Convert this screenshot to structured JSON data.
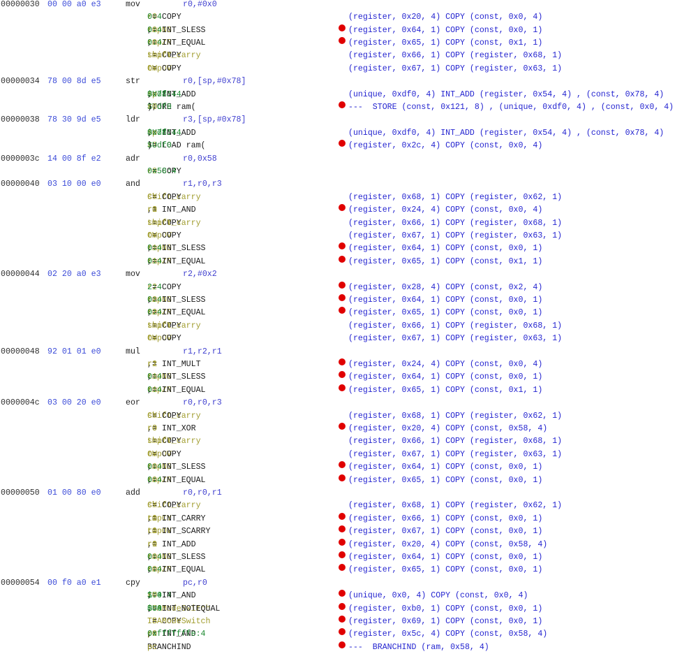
{
  "instructions": [
    {
      "addr": "00000030",
      "bytes": "00 00 a0 e3",
      "mnemonic": "mov",
      "operands": "r0,#0x0",
      "pcode": [
        {
          "tokens": [
            [
              "n",
              "r0"
            ],
            [
              "k",
              " = COPY "
            ],
            [
              "c",
              "0:4"
            ]
          ],
          "bp": false,
          "raw": "(register, 0x20, 4) COPY (const, 0x0, 4)"
        },
        {
          "tokens": [
            [
              "n",
              "tmpNG"
            ],
            [
              "k",
              " = INT_SLESS "
            ],
            [
              "n",
              "r0"
            ],
            [
              "k",
              ", "
            ],
            [
              "c",
              "0:4"
            ]
          ],
          "bp": true,
          "raw": "(register, 0x64, 1) COPY (const, 0x0, 1)"
        },
        {
          "tokens": [
            [
              "n",
              "tmpZR"
            ],
            [
              "k",
              " = INT_EQUAL "
            ],
            [
              "n",
              "r0"
            ],
            [
              "k",
              ", "
            ],
            [
              "c",
              "0:4"
            ]
          ],
          "bp": true,
          "raw": "(register, 0x65, 1) COPY (const, 0x1, 1)"
        },
        {
          "tokens": [
            [
              "n",
              "tmpCY"
            ],
            [
              "k",
              " = COPY "
            ],
            [
              "n",
              "shift_carry"
            ]
          ],
          "bp": false,
          "raw": "(register, 0x66, 1) COPY (register, 0x68, 1)"
        },
        {
          "tokens": [
            [
              "n",
              "tmpOV"
            ],
            [
              "k",
              " = COPY "
            ],
            [
              "n",
              "OV"
            ]
          ],
          "bp": false,
          "raw": "(register, 0x67, 1) COPY (register, 0x63, 1)"
        }
      ]
    },
    {
      "addr": "00000034",
      "bytes": "78 00 8d e5",
      "mnemonic": "str",
      "operands": "r0,[sp,#0x78]",
      "pcode": [
        {
          "tokens": [
            [
              "c",
              "$Udf0:4"
            ],
            [
              "k",
              " = INT_ADD "
            ],
            [
              "n",
              "sp"
            ],
            [
              "k",
              ", "
            ],
            [
              "c",
              "0x78:4"
            ]
          ],
          "bp": false,
          "raw": "(unique, 0xdf0, 4) INT_ADD (register, 0x54, 4) , (const, 0x78, 4)"
        },
        {
          "tokens": [
            [
              "k",
              "STORE ram("
            ],
            [
              "c",
              "$Udf0"
            ],
            [
              "k",
              "), "
            ],
            [
              "n",
              "r0"
            ]
          ],
          "bp": true,
          "raw": "---  STORE (const, 0x121, 8) , (unique, 0xdf0, 4) , (const, 0x0, 4)"
        }
      ]
    },
    {
      "addr": "00000038",
      "bytes": "78 30 9d e5",
      "mnemonic": "ldr",
      "operands": "r3,[sp,#0x78]",
      "pcode": [
        {
          "tokens": [
            [
              "c",
              "$Udf0:4"
            ],
            [
              "k",
              " = INT_ADD "
            ],
            [
              "n",
              "sp"
            ],
            [
              "k",
              ", "
            ],
            [
              "c",
              "0x78:4"
            ]
          ],
          "bp": false,
          "raw": "(unique, 0xdf0, 4) INT_ADD (register, 0x54, 4) , (const, 0x78, 4)"
        },
        {
          "tokens": [
            [
              "n",
              "r3"
            ],
            [
              "k",
              " = LOAD ram("
            ],
            [
              "c",
              "$Udf0"
            ],
            [
              "k",
              ")"
            ]
          ],
          "bp": true,
          "raw": "(register, 0x2c, 4) COPY (const, 0x0, 4)"
        }
      ]
    },
    {
      "addr": "0000003c",
      "bytes": "14 00 8f e2",
      "mnemonic": "adr",
      "operands": "r0,0x58",
      "pcode": [
        {
          "tokens": [
            [
              "n",
              "r0"
            ],
            [
              "k",
              " = COPY "
            ],
            [
              "c",
              "0x58:4"
            ]
          ],
          "bp": false,
          "raw": ""
        }
      ]
    },
    {
      "addr": "00000040",
      "bytes": "03 10 00 e0",
      "mnemonic": "and",
      "operands": "r1,r0,r3",
      "pcode": [
        {
          "tokens": [
            [
              "n",
              "shift_carry"
            ],
            [
              "k",
              " = COPY "
            ],
            [
              "n",
              "CY"
            ]
          ],
          "bp": false,
          "raw": "(register, 0x68, 1) COPY (register, 0x62, 1)"
        },
        {
          "tokens": [
            [
              "n",
              "r1"
            ],
            [
              "k",
              " = INT_AND "
            ],
            [
              "n",
              "r0"
            ],
            [
              "k",
              ", "
            ],
            [
              "n",
              "r3"
            ]
          ],
          "bp": true,
          "raw": "(register, 0x24, 4) COPY (const, 0x0, 4)"
        },
        {
          "tokens": [
            [
              "n",
              "tmpCY"
            ],
            [
              "k",
              " = COPY "
            ],
            [
              "n",
              "shift_carry"
            ]
          ],
          "bp": false,
          "raw": "(register, 0x66, 1) COPY (register, 0x68, 1)"
        },
        {
          "tokens": [
            [
              "n",
              "tmpOV"
            ],
            [
              "k",
              " = COPY "
            ],
            [
              "n",
              "OV"
            ]
          ],
          "bp": false,
          "raw": "(register, 0x67, 1) COPY (register, 0x63, 1)"
        },
        {
          "tokens": [
            [
              "n",
              "tmpNG"
            ],
            [
              "k",
              " = INT_SLESS "
            ],
            [
              "n",
              "r1"
            ],
            [
              "k",
              ", "
            ],
            [
              "c",
              "0:4"
            ]
          ],
          "bp": true,
          "raw": "(register, 0x64, 1) COPY (const, 0x0, 1)"
        },
        {
          "tokens": [
            [
              "n",
              "tmpZR"
            ],
            [
              "k",
              " = INT_EQUAL "
            ],
            [
              "n",
              "r1"
            ],
            [
              "k",
              ", "
            ],
            [
              "c",
              "0:4"
            ]
          ],
          "bp": true,
          "raw": "(register, 0x65, 1) COPY (const, 0x1, 1)"
        }
      ]
    },
    {
      "addr": "00000044",
      "bytes": "02 20 a0 e3",
      "mnemonic": "mov",
      "operands": "r2,#0x2",
      "pcode": [
        {
          "tokens": [
            [
              "n",
              "r2"
            ],
            [
              "k",
              " = COPY "
            ],
            [
              "c",
              "2:4"
            ]
          ],
          "bp": true,
          "raw": "(register, 0x28, 4) COPY (const, 0x2, 4)"
        },
        {
          "tokens": [
            [
              "n",
              "tmpNG"
            ],
            [
              "k",
              " = INT_SLESS "
            ],
            [
              "n",
              "r2"
            ],
            [
              "k",
              ", "
            ],
            [
              "c",
              "0:4"
            ]
          ],
          "bp": true,
          "raw": "(register, 0x64, 1) COPY (const, 0x0, 1)"
        },
        {
          "tokens": [
            [
              "n",
              "tmpZR"
            ],
            [
              "k",
              " = INT_EQUAL "
            ],
            [
              "n",
              "r2"
            ],
            [
              "k",
              ", "
            ],
            [
              "c",
              "0:4"
            ]
          ],
          "bp": true,
          "raw": "(register, 0x65, 1) COPY (const, 0x0, 1)"
        },
        {
          "tokens": [
            [
              "n",
              "tmpCY"
            ],
            [
              "k",
              " = COPY "
            ],
            [
              "n",
              "shift_carry"
            ]
          ],
          "bp": false,
          "raw": "(register, 0x66, 1) COPY (register, 0x68, 1)"
        },
        {
          "tokens": [
            [
              "n",
              "tmpOV"
            ],
            [
              "k",
              " = COPY "
            ],
            [
              "n",
              "OV"
            ]
          ],
          "bp": false,
          "raw": "(register, 0x67, 1) COPY (register, 0x63, 1)"
        }
      ]
    },
    {
      "addr": "00000048",
      "bytes": "92 01 01 e0",
      "mnemonic": "mul",
      "operands": "r1,r2,r1",
      "pcode": [
        {
          "tokens": [
            [
              "n",
              "r1"
            ],
            [
              "k",
              " = INT_MULT "
            ],
            [
              "n",
              "r2"
            ],
            [
              "k",
              ", "
            ],
            [
              "n",
              "r1"
            ]
          ],
          "bp": true,
          "raw": "(register, 0x24, 4) COPY (const, 0x0, 4)"
        },
        {
          "tokens": [
            [
              "n",
              "tmpNG"
            ],
            [
              "k",
              " = INT_SLESS "
            ],
            [
              "n",
              "r1"
            ],
            [
              "k",
              ", "
            ],
            [
              "c",
              "0:4"
            ]
          ],
          "bp": true,
          "raw": "(register, 0x64, 1) COPY (const, 0x0, 1)"
        },
        {
          "tokens": [
            [
              "n",
              "tmpZR"
            ],
            [
              "k",
              " = INT_EQUAL "
            ],
            [
              "n",
              "r1"
            ],
            [
              "k",
              ", "
            ],
            [
              "c",
              "0:4"
            ]
          ],
          "bp": true,
          "raw": "(register, 0x65, 1) COPY (const, 0x1, 1)"
        }
      ]
    },
    {
      "addr": "0000004c",
      "bytes": "03 00 20 e0",
      "mnemonic": "eor",
      "operands": "r0,r0,r3",
      "pcode": [
        {
          "tokens": [
            [
              "n",
              "shift_carry"
            ],
            [
              "k",
              " = COPY "
            ],
            [
              "n",
              "CY"
            ]
          ],
          "bp": false,
          "raw": "(register, 0x68, 1) COPY (register, 0x62, 1)"
        },
        {
          "tokens": [
            [
              "n",
              "r0"
            ],
            [
              "k",
              " = INT_XOR "
            ],
            [
              "n",
              "r0"
            ],
            [
              "k",
              ", "
            ],
            [
              "n",
              "r3"
            ]
          ],
          "bp": true,
          "raw": "(register, 0x20, 4) COPY (const, 0x58, 4)"
        },
        {
          "tokens": [
            [
              "n",
              "tmpCY"
            ],
            [
              "k",
              " = COPY "
            ],
            [
              "n",
              "shift_carry"
            ]
          ],
          "bp": false,
          "raw": "(register, 0x66, 1) COPY (register, 0x68, 1)"
        },
        {
          "tokens": [
            [
              "n",
              "tmpOV"
            ],
            [
              "k",
              " = COPY "
            ],
            [
              "n",
              "OV"
            ]
          ],
          "bp": false,
          "raw": "(register, 0x67, 1) COPY (register, 0x63, 1)"
        },
        {
          "tokens": [
            [
              "n",
              "tmpNG"
            ],
            [
              "k",
              " = INT_SLESS "
            ],
            [
              "n",
              "r0"
            ],
            [
              "k",
              ", "
            ],
            [
              "c",
              "0:4"
            ]
          ],
          "bp": true,
          "raw": "(register, 0x64, 1) COPY (const, 0x0, 1)"
        },
        {
          "tokens": [
            [
              "n",
              "tmpZR"
            ],
            [
              "k",
              " = INT_EQUAL "
            ],
            [
              "n",
              "r0"
            ],
            [
              "k",
              ", "
            ],
            [
              "c",
              "0:4"
            ]
          ],
          "bp": true,
          "raw": "(register, 0x65, 1) COPY (const, 0x0, 1)"
        }
      ]
    },
    {
      "addr": "00000050",
      "bytes": "01 00 80 e0",
      "mnemonic": "add",
      "operands": "r0,r0,r1",
      "pcode": [
        {
          "tokens": [
            [
              "n",
              "shift_carry"
            ],
            [
              "k",
              " = COPY "
            ],
            [
              "n",
              "CY"
            ]
          ],
          "bp": false,
          "raw": "(register, 0x68, 1) COPY (register, 0x62, 1)"
        },
        {
          "tokens": [
            [
              "n",
              "tmpCY"
            ],
            [
              "k",
              " = INT_CARRY "
            ],
            [
              "n",
              "r0"
            ],
            [
              "k",
              ", "
            ],
            [
              "n",
              "r1"
            ]
          ],
          "bp": true,
          "raw": "(register, 0x66, 1) COPY (const, 0x0, 1)"
        },
        {
          "tokens": [
            [
              "n",
              "tmpOV"
            ],
            [
              "k",
              " = INT_SCARRY "
            ],
            [
              "n",
              "r0"
            ],
            [
              "k",
              ", "
            ],
            [
              "n",
              "r1"
            ]
          ],
          "bp": true,
          "raw": "(register, 0x67, 1) COPY (const, 0x0, 1)"
        },
        {
          "tokens": [
            [
              "n",
              "r0"
            ],
            [
              "k",
              " = INT_ADD "
            ],
            [
              "n",
              "r0"
            ],
            [
              "k",
              ", "
            ],
            [
              "n",
              "r1"
            ]
          ],
          "bp": true,
          "raw": "(register, 0x20, 4) COPY (const, 0x58, 4)"
        },
        {
          "tokens": [
            [
              "n",
              "tmpNG"
            ],
            [
              "k",
              " = INT_SLESS "
            ],
            [
              "n",
              "r0"
            ],
            [
              "k",
              ", "
            ],
            [
              "c",
              "0:4"
            ]
          ],
          "bp": true,
          "raw": "(register, 0x64, 1) COPY (const, 0x0, 1)"
        },
        {
          "tokens": [
            [
              "n",
              "tmpZR"
            ],
            [
              "k",
              " = INT_EQUAL "
            ],
            [
              "n",
              "r0"
            ],
            [
              "k",
              ", "
            ],
            [
              "c",
              "0:4"
            ]
          ],
          "bp": true,
          "raw": "(register, 0x65, 1) COPY (const, 0x0, 1)"
        }
      ]
    },
    {
      "addr": "00000054",
      "bytes": "00 f0 a0 e1",
      "mnemonic": "cpy",
      "operands": "pc,r0",
      "pcode": [
        {
          "tokens": [
            [
              "c",
              "$U0:4"
            ],
            [
              "k",
              " = INT_AND "
            ],
            [
              "n",
              "r0"
            ],
            [
              "k",
              ", "
            ],
            [
              "c",
              "1:4"
            ]
          ],
          "bp": true,
          "raw": "(unique, 0x0, 4) COPY (const, 0x0, 4)"
        },
        {
          "tokens": [
            [
              "n",
              "ISAModeSwitch"
            ],
            [
              "k",
              " = INT_NOTEQUAL "
            ],
            [
              "c",
              "$U0"
            ],
            [
              "k",
              ", "
            ],
            [
              "c",
              "0:4"
            ]
          ],
          "bp": true,
          "raw": "(register, 0xb0, 1) COPY (const, 0x0, 1)"
        },
        {
          "tokens": [
            [
              "n",
              "TB"
            ],
            [
              "k",
              " = COPY "
            ],
            [
              "n",
              "ISAModeSwitch"
            ]
          ],
          "bp": true,
          "raw": "(register, 0x69, 1) COPY (const, 0x0, 1)"
        },
        {
          "tokens": [
            [
              "n",
              "pc"
            ],
            [
              "k",
              " = INT_AND "
            ],
            [
              "n",
              "r0"
            ],
            [
              "k",
              ", "
            ],
            [
              "c",
              "0xfffffffe:4"
            ]
          ],
          "bp": true,
          "raw": "(register, 0x5c, 4) COPY (const, 0x58, 4)"
        },
        {
          "tokens": [
            [
              "k",
              "BRANCHIND "
            ],
            [
              "n",
              "pc"
            ]
          ],
          "bp": true,
          "raw": "---  BRANCHIND (ram, 0x58, 4)"
        }
      ]
    }
  ],
  "colors": {
    "address": "#2e2e2e",
    "bytes": "#3a4ad8",
    "mnemonic": "#222222",
    "operands": "#3f3fcf",
    "pcode_name": "#a19d2f",
    "pcode_keyword": "#1a1a1a",
    "pcode_constant": "#1f8a32",
    "raw_pcode": "#2424d0",
    "breakpoint": "#e00000"
  },
  "icons": {
    "breakpoint": "breakpoint-dot-icon"
  }
}
